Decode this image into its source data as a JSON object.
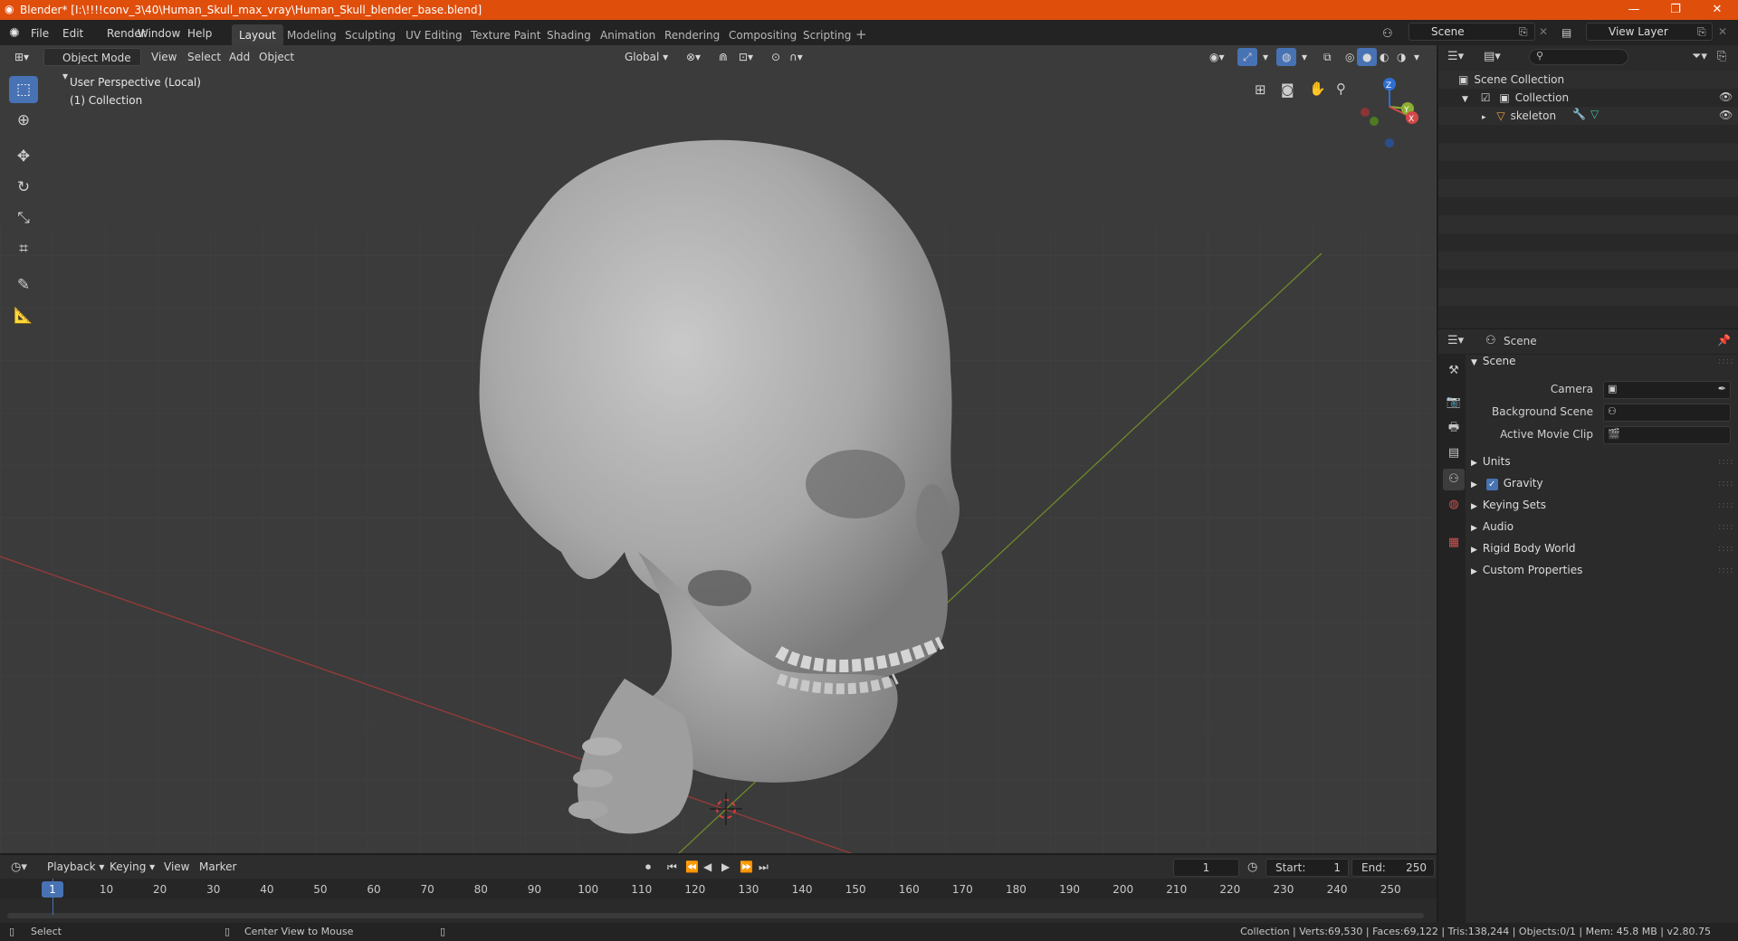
{
  "title_bar": {
    "title": "Blender* [I:\\!!!!conv_3\\40\\Human_Skull_max_vray\\Human_Skull_blender_base.blend]"
  },
  "menu": [
    "File",
    "Edit",
    "Render",
    "Window",
    "Help"
  ],
  "workspaces": [
    "Layout",
    "Modeling",
    "Sculpting",
    "UV Editing",
    "Texture Paint",
    "Shading",
    "Animation",
    "Rendering",
    "Compositing",
    "Scripting"
  ],
  "scene_field": "Scene",
  "view_layer_field": "View Layer",
  "viewport_header": {
    "mode": "Object Mode",
    "menus": [
      "View",
      "Select",
      "Add",
      "Object"
    ],
    "transform": "Global"
  },
  "viewport_overlay": {
    "perspective": "User Perspective (Local)",
    "collection": "(1) Collection"
  },
  "gizmo": {
    "z": "Z",
    "y": "Y",
    "x": "X"
  },
  "outliner": {
    "root": "Scene Collection",
    "collection": "Collection",
    "object": "skeleton"
  },
  "properties": {
    "header": "Scene",
    "panel_title": "Scene",
    "fields": [
      {
        "label": "Camera"
      },
      {
        "label": "Background Scene"
      },
      {
        "label": "Active Movie Clip"
      }
    ],
    "sections": [
      "Units",
      "Gravity",
      "Keying Sets",
      "Audio",
      "Rigid Body World",
      "Custom Properties"
    ]
  },
  "timeline": {
    "menus": [
      "Playback",
      "Keying",
      "View",
      "Marker"
    ],
    "current_frame": "1",
    "start_label": "Start:",
    "start": "1",
    "end_label": "End:",
    "end": "250",
    "ticks": [
      "10",
      "20",
      "30",
      "40",
      "50",
      "60",
      "70",
      "80",
      "90",
      "100",
      "110",
      "120",
      "130",
      "140",
      "150",
      "160",
      "170",
      "180",
      "190",
      "200",
      "210",
      "220",
      "230",
      "240",
      "250"
    ]
  },
  "status_bar": {
    "left": "Select",
    "middle": "Center View to Mouse",
    "right": "Collection | Verts:69,530 | Faces:69,122 | Tris:138,244 | Objects:0/1 | Mem: 45.8 MB | v2.80.75"
  }
}
